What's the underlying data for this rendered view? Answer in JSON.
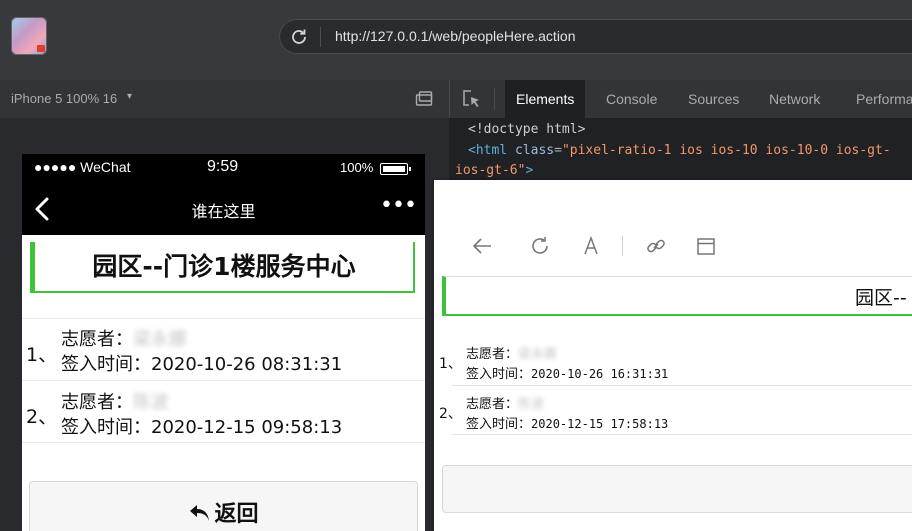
{
  "browser": {
    "url": "http://127.0.0.1/web/peopleHere.action"
  },
  "device_toolbar": {
    "device_label": "iPhone 5 100% 16",
    "caret": "▾"
  },
  "devtools": {
    "tabs": [
      "Elements",
      "Console",
      "Sources",
      "Network",
      "Performa"
    ],
    "active_tab": "Elements",
    "code_lines": {
      "doctype": "<!doctype html>",
      "html_open": "<html",
      "class_attr": "class",
      "class_value_1": "\"pixel-ratio-1 ios ios-10 ios-10-0 ios-gt-",
      "class_value_2": "ios-gt-6\"",
      "close": ">"
    }
  },
  "phone": {
    "status": {
      "signal": "●●●●● WeChat",
      "time": "9:59",
      "battery": "100%"
    },
    "nav": {
      "title": "谁在这里",
      "more": "•••"
    },
    "heading": "园区--门诊1楼服务中心",
    "entries": [
      {
        "index": "1、",
        "volunteer_label": "志愿者：",
        "volunteer_name": "梁永娜",
        "time_label": "签入时间：",
        "time": "2020-10-26 08:31:31"
      },
      {
        "index": "2、",
        "volunteer_label": "志愿者：",
        "volunteer_name": "陈波",
        "time_label": "签入时间：",
        "time": "2020-12-15 09:58:13"
      }
    ],
    "return_button": "返回"
  },
  "preview": {
    "heading": "园区--",
    "entries": [
      {
        "index": "1、",
        "volunteer_label": "志愿者：",
        "volunteer_name": "梁永娜",
        "time_label": "签入时间：",
        "time": "2020-10-26 16:31:31"
      },
      {
        "index": "2、",
        "volunteer_label": "志愿者：",
        "volunteer_name": "陈波",
        "time_label": "签入时间：",
        "time": "2020-12-15 17:58:13"
      }
    ]
  },
  "colors": {
    "accent_green": "#3ec238",
    "devtools_bg": "#202124",
    "toolbar_bg": "#333437"
  }
}
